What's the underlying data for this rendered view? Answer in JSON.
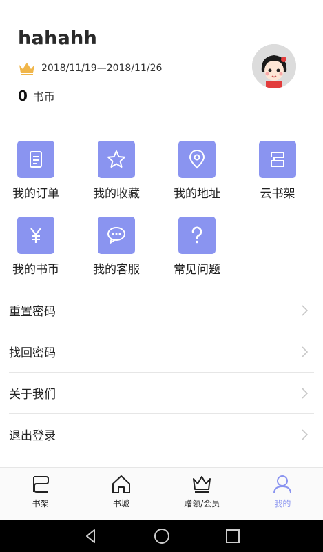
{
  "profile": {
    "username": "hahahh",
    "vip_range": "2018/11/19—2018/11/26",
    "coin_count": "0",
    "coin_unit": "书币"
  },
  "colors": {
    "accent": "#8a94f0",
    "crown": "#f0b64a"
  },
  "grid": [
    {
      "label": "我的订单",
      "icon": "order-icon"
    },
    {
      "label": "我的收藏",
      "icon": "star-icon"
    },
    {
      "label": "我的地址",
      "icon": "location-icon"
    },
    {
      "label": "云书架",
      "icon": "cloud-shelf-icon"
    },
    {
      "label": "我的书币",
      "icon": "yen-icon"
    },
    {
      "label": "我的客服",
      "icon": "chat-icon"
    },
    {
      "label": "常见问题",
      "icon": "question-icon"
    }
  ],
  "menu": [
    {
      "label": "重置密码"
    },
    {
      "label": "找回密码"
    },
    {
      "label": "关于我们"
    },
    {
      "label": "退出登录"
    }
  ],
  "tabs": [
    {
      "label": "书架",
      "icon": "bookshelf-icon"
    },
    {
      "label": "书城",
      "icon": "bookstore-icon"
    },
    {
      "label": "赠领/会员",
      "icon": "crown-icon"
    },
    {
      "label": "我的",
      "icon": "user-icon",
      "active": true
    }
  ],
  "system_nav": [
    "back-icon",
    "home-icon",
    "recents-icon"
  ]
}
